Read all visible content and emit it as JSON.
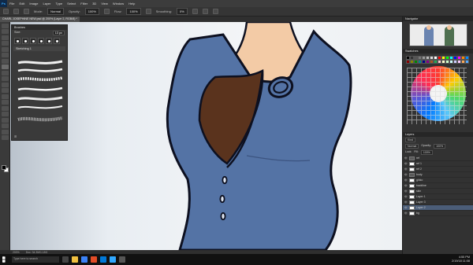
{
  "app": {
    "logo": "Ps"
  },
  "menu": [
    "File",
    "Edit",
    "Image",
    "Layer",
    "Type",
    "Select",
    "Filter",
    "3D",
    "View",
    "Window",
    "Help"
  ],
  "options_bar": {
    "mode_label": "Mode:",
    "mode_value": "Normal",
    "opacity_label": "Opacity:",
    "opacity_value": "100%",
    "flow_label": "Flow:",
    "flow_value": "100%",
    "smoothing_label": "Smoothing:",
    "smoothing_value": "0%"
  },
  "document_tab": "CHARL JOSEPHINE NEW.psd @ 200% (Layer 2, RGB/8) *",
  "brush_panel": {
    "title": "Brushes",
    "size_label": "Size:",
    "size_value": "13 px",
    "folder": "Sketching 1",
    "footer": "⊞"
  },
  "status_bar": {
    "zoom": "200%",
    "doc": "Doc: 34.3M/1.18G"
  },
  "navigator": {
    "title": "Navigator"
  },
  "swatches": {
    "title": "Swatches"
  },
  "layers": {
    "title": "Layers",
    "kind_label": "Kind",
    "blend_value": "Normal",
    "opacity_label": "Opacity:",
    "opacity_value": "100%",
    "lock_label": "Lock:",
    "fill_label": "Fill:",
    "fill_value": "100%",
    "items": [
      {
        "name": "ref",
        "type": "group"
      },
      {
        "name": "ref 1",
        "type": "layer"
      },
      {
        "name": "ref 2",
        "type": "layer"
      },
      {
        "name": "body",
        "type": "group"
      },
      {
        "name": "ginko",
        "type": "layer"
      },
      {
        "name": "backline",
        "type": "layer"
      },
      {
        "name": "skin",
        "type": "layer"
      },
      {
        "name": "Layer 1",
        "type": "layer"
      },
      {
        "name": "Layer 3",
        "type": "layer"
      },
      {
        "name": "Layer 2",
        "type": "layer",
        "selected": true
      },
      {
        "name": "bg",
        "type": "layer"
      }
    ]
  },
  "taskbar": {
    "search_placeholder": "Type here to search",
    "time": "4:55 PM",
    "date": "2/19/18 11:08"
  },
  "colors": {
    "jacket": "#5473a5",
    "shirt": "#5a331d",
    "skin": "#f3cba6",
    "outline": "#0d1020"
  }
}
